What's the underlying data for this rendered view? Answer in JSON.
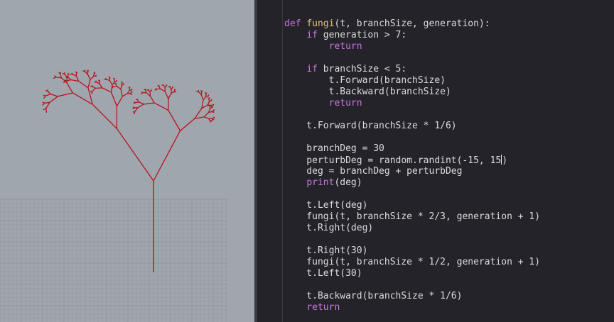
{
  "colors": {
    "viewport_bg": "#a0a6ad",
    "grid": "#8f959c",
    "tree": "#b5151e",
    "editor_bg": "#25232a",
    "text": "#dcdcdc",
    "keyword": "#c678dd",
    "function_name": "#e5c07b"
  },
  "editor": {
    "lines": [
      [
        {
          "t": "  ... ",
          "c": ""
        }
      ],
      [
        {
          "t": "",
          "c": ""
        }
      ],
      [
        {
          "t": "def ",
          "c": "kw"
        },
        {
          "t": "fungi",
          "c": "fn"
        },
        {
          "t": "(t, branchSize, generation):",
          "c": ""
        }
      ],
      [
        {
          "t": "    ",
          "c": ""
        },
        {
          "t": "if",
          "c": "kw"
        },
        {
          "t": " generation > 7:",
          "c": ""
        }
      ],
      [
        {
          "t": "        ",
          "c": ""
        },
        {
          "t": "return",
          "c": "kw"
        }
      ],
      [
        {
          "t": "",
          "c": ""
        }
      ],
      [
        {
          "t": "    ",
          "c": ""
        },
        {
          "t": "if",
          "c": "kw"
        },
        {
          "t": " branchSize < 5:",
          "c": ""
        }
      ],
      [
        {
          "t": "        t.Forward(branchSize)",
          "c": ""
        }
      ],
      [
        {
          "t": "        t.Backward(branchSize)",
          "c": ""
        }
      ],
      [
        {
          "t": "        ",
          "c": ""
        },
        {
          "t": "return",
          "c": "kw"
        }
      ],
      [
        {
          "t": "",
          "c": ""
        }
      ],
      [
        {
          "t": "    t.Forward(branchSize * 1/6)",
          "c": ""
        }
      ],
      [
        {
          "t": "",
          "c": ""
        }
      ],
      [
        {
          "t": "    branchDeg = 30",
          "c": ""
        }
      ],
      [
        {
          "t": "    perturbDeg = random.randint(-15, 15",
          "c": ""
        },
        {
          "t": "|",
          "c": "cursor"
        },
        {
          "t": ")",
          "c": ""
        }
      ],
      [
        {
          "t": "    deg = branchDeg + perturbDeg",
          "c": ""
        }
      ],
      [
        {
          "t": "    ",
          "c": ""
        },
        {
          "t": "print",
          "c": "bi"
        },
        {
          "t": "(deg)",
          "c": ""
        }
      ],
      [
        {
          "t": "",
          "c": ""
        }
      ],
      [
        {
          "t": "    t.Left(deg)",
          "c": ""
        }
      ],
      [
        {
          "t": "    fungi(t, branchSize * 2/3, generation + 1)",
          "c": ""
        }
      ],
      [
        {
          "t": "    t.Right(deg)",
          "c": ""
        }
      ],
      [
        {
          "t": "",
          "c": ""
        }
      ],
      [
        {
          "t": "    t.Right(30)",
          "c": ""
        }
      ],
      [
        {
          "t": "    fungi(t, branchSize * 1/2, generation + 1)",
          "c": ""
        }
      ],
      [
        {
          "t": "    t.Left(30)",
          "c": ""
        }
      ],
      [
        {
          "t": "",
          "c": ""
        }
      ],
      [
        {
          "t": "    t.Backward(branchSize * 1/6)",
          "c": ""
        }
      ],
      [
        {
          "t": "    ",
          "c": ""
        },
        {
          "t": "return",
          "c": "kw"
        }
      ]
    ]
  }
}
